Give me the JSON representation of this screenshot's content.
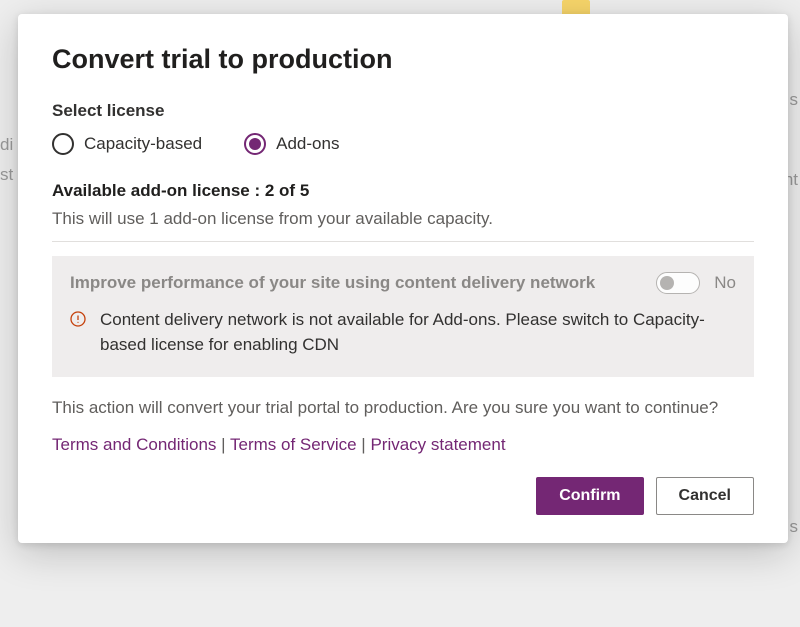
{
  "dialog": {
    "title": "Convert trial to production",
    "select_license_label": "Select license",
    "radio_capacity": "Capacity-based",
    "radio_addons": "Add-ons",
    "available_label": "Available add-on license : 2 of 5",
    "available_desc": "This will use 1 add-on license from your available capacity.",
    "cdn": {
      "title": "Improve performance of your site using content delivery network",
      "toggle_state": "No",
      "message": "Content delivery network is not available for Add-ons. Please switch to Capacity-based license for enabling CDN"
    },
    "confirm_text": "This action will convert your trial portal to production. Are you sure you want to continue?",
    "links": {
      "terms_conditions": "Terms and Conditions",
      "terms_service": "Terms of Service",
      "privacy": "Privacy statement",
      "sep": " | "
    },
    "buttons": {
      "confirm": "Confirm",
      "cancel": "Cancel"
    }
  }
}
